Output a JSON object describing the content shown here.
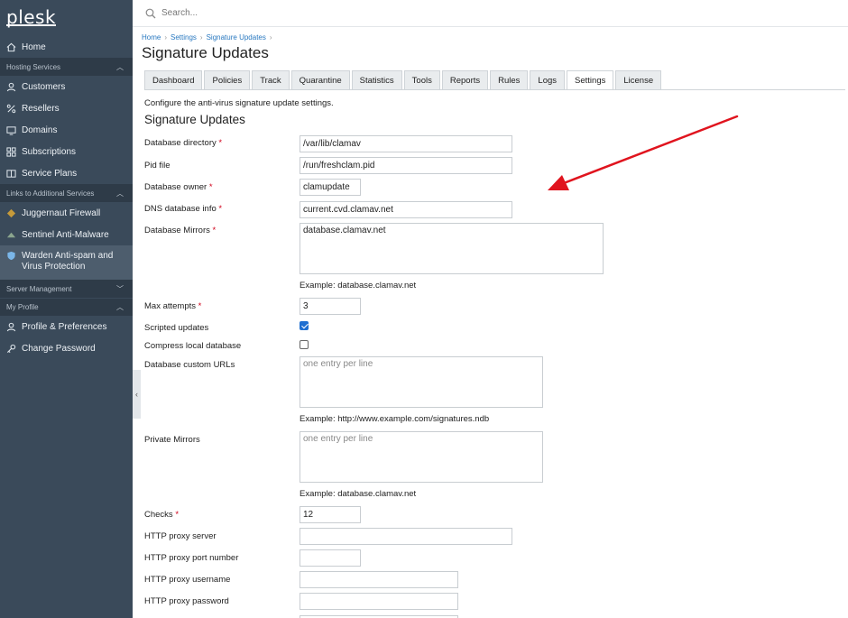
{
  "sidebar": {
    "logo": "plesk",
    "items": [
      {
        "label": "Home"
      },
      {
        "group": "Hosting Services"
      },
      {
        "label": "Customers"
      },
      {
        "label": "Resellers"
      },
      {
        "label": "Domains"
      },
      {
        "label": "Subscriptions"
      },
      {
        "label": "Service Plans"
      },
      {
        "group": "Links to Additional Services"
      },
      {
        "label": "Juggernaut Firewall"
      },
      {
        "label": "Sentinel Anti-Malware"
      },
      {
        "label": "Warden Anti-spam and Virus Protection"
      },
      {
        "group": "Server Management"
      },
      {
        "group": "My Profile"
      },
      {
        "label": "Profile & Preferences"
      },
      {
        "label": "Change Password"
      }
    ]
  },
  "search": {
    "placeholder": "Search..."
  },
  "breadcrumb": [
    "Home",
    "Settings",
    "Signature Updates"
  ],
  "page_title": "Signature Updates",
  "tabs": [
    "Dashboard",
    "Policies",
    "Track",
    "Quarantine",
    "Statistics",
    "Tools",
    "Reports",
    "Rules",
    "Logs",
    "Settings",
    "License"
  ],
  "active_tab": "Settings",
  "description": "Configure the anti-virus signature update settings.",
  "section_title": "Signature Updates",
  "form": {
    "database_directory": {
      "label": "Database directory",
      "value": "/var/lib/clamav"
    },
    "pid_file": {
      "label": "Pid file",
      "value": "/run/freshclam.pid"
    },
    "database_owner": {
      "label": "Database owner",
      "value": "clamupdate"
    },
    "dns_database_info": {
      "label": "DNS database info",
      "value": "current.cvd.clamav.net"
    },
    "database_mirrors": {
      "label": "Database Mirrors",
      "value": "database.clamav.net",
      "hint": "Example: database.clamav.net"
    },
    "max_attempts": {
      "label": "Max attempts",
      "value": "3"
    },
    "scripted_updates": {
      "label": "Scripted updates",
      "checked": true
    },
    "compress_local_database": {
      "label": "Compress local database",
      "checked": false
    },
    "database_custom_urls": {
      "label": "Database custom URLs",
      "placeholder": "one entry per line",
      "hint": "Example: http://www.example.com/signatures.ndb"
    },
    "private_mirrors": {
      "label": "Private Mirrors",
      "placeholder": "one entry per line",
      "hint": "Example: database.clamav.net"
    },
    "checks": {
      "label": "Checks",
      "value": "12"
    },
    "http_proxy_server": {
      "label": "HTTP proxy server",
      "value": ""
    },
    "http_proxy_port": {
      "label": "HTTP proxy port number",
      "value": ""
    },
    "http_proxy_username": {
      "label": "HTTP proxy username",
      "value": ""
    },
    "http_proxy_password": {
      "label": "HTTP proxy password",
      "value": ""
    }
  },
  "required_mark": "*",
  "colors": {
    "sidebar_bg": "#3a4a5a",
    "link": "#2878c0",
    "required": "#d0021b",
    "annotation_arrow": "#e0141e",
    "checkbox": "#1f6fd1"
  }
}
